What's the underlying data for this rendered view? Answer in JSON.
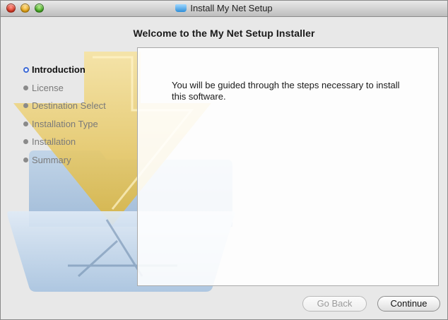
{
  "window": {
    "title": "Install My Net Setup",
    "heading": "Welcome to the My Net Setup Installer"
  },
  "sidebar": {
    "steps": [
      {
        "label": "Introduction",
        "active": true
      },
      {
        "label": "License",
        "active": false
      },
      {
        "label": "Destination Select",
        "active": false
      },
      {
        "label": "Installation Type",
        "active": false
      },
      {
        "label": "Installation",
        "active": false
      },
      {
        "label": "Summary",
        "active": false
      }
    ]
  },
  "content": {
    "message": "You will be guided through the steps necessary to install this software."
  },
  "buttons": {
    "back_label": "Go Back",
    "continue_label": "Continue"
  },
  "icons": {
    "title_icon": "installer-package-icon",
    "background_art": "installer-folder-arrow-icon"
  },
  "colors": {
    "active_step_ring": "#3d6ad6",
    "inactive_step_dot": "#8a8a8a"
  }
}
